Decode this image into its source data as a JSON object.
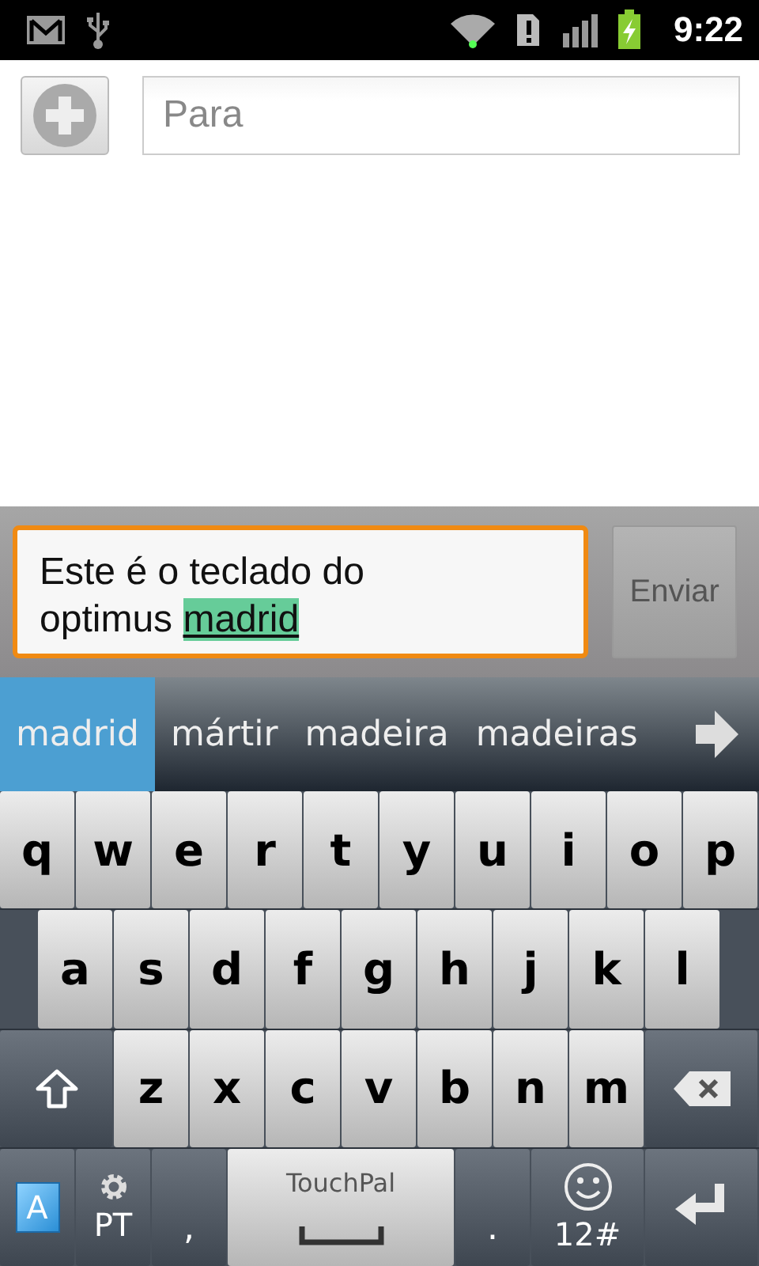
{
  "status_bar": {
    "time": "9:22"
  },
  "compose": {
    "recipient_placeholder": "Para",
    "message": {
      "text": "Este é o teclado do optimus",
      "composing": "madrid"
    },
    "send_button": "Enviar"
  },
  "suggestions": [
    {
      "label": "madrid",
      "selected": true
    },
    {
      "label": "mártir",
      "selected": false
    },
    {
      "label": "madeira",
      "selected": false
    },
    {
      "label": "madeiras",
      "selected": false
    }
  ],
  "keyboard": {
    "rows": [
      {
        "keys": [
          {
            "kind": "letter",
            "label": "q"
          },
          {
            "kind": "letter",
            "label": "w"
          },
          {
            "kind": "letter",
            "label": "e"
          },
          {
            "kind": "letter",
            "label": "r"
          },
          {
            "kind": "letter",
            "label": "t"
          },
          {
            "kind": "letter",
            "label": "y"
          },
          {
            "kind": "letter",
            "label": "u"
          },
          {
            "kind": "letter",
            "label": "i"
          },
          {
            "kind": "letter",
            "label": "o"
          },
          {
            "kind": "letter",
            "label": "p"
          }
        ]
      },
      {
        "keys": [
          {
            "kind": "letter",
            "label": "a"
          },
          {
            "kind": "letter",
            "label": "s"
          },
          {
            "kind": "letter",
            "label": "d"
          },
          {
            "kind": "letter",
            "label": "f"
          },
          {
            "kind": "letter",
            "label": "g"
          },
          {
            "kind": "letter",
            "label": "h"
          },
          {
            "kind": "letter",
            "label": "j"
          },
          {
            "kind": "letter",
            "label": "k"
          },
          {
            "kind": "letter",
            "label": "l"
          }
        ]
      },
      {
        "keys": [
          {
            "kind": "shift"
          },
          {
            "kind": "letter",
            "label": "z"
          },
          {
            "kind": "letter",
            "label": "x"
          },
          {
            "kind": "letter",
            "label": "c"
          },
          {
            "kind": "letter",
            "label": "v"
          },
          {
            "kind": "letter",
            "label": "b"
          },
          {
            "kind": "letter",
            "label": "n"
          },
          {
            "kind": "letter",
            "label": "m"
          },
          {
            "kind": "backspace"
          }
        ]
      },
      {
        "keys": [
          {
            "kind": "layout",
            "label": "A"
          },
          {
            "kind": "language",
            "label": "PT"
          },
          {
            "kind": "punct",
            "label": ","
          },
          {
            "kind": "space",
            "label": "TouchPal"
          },
          {
            "kind": "punct",
            "label": "."
          },
          {
            "kind": "symbols",
            "label": "12#"
          },
          {
            "kind": "enter"
          }
        ]
      }
    ]
  }
}
